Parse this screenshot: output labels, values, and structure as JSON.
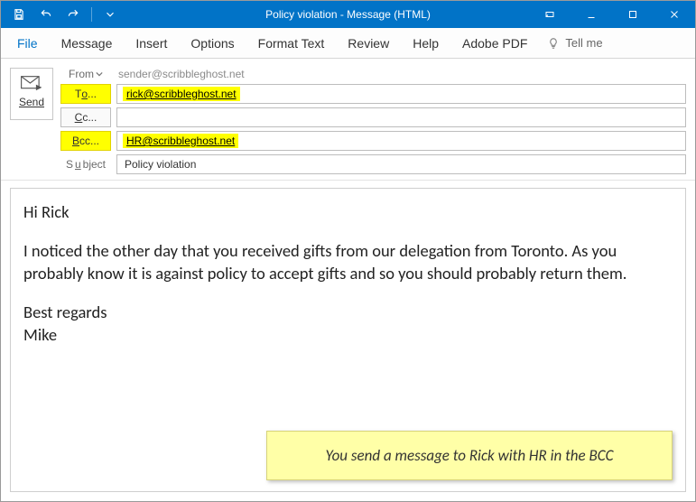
{
  "window": {
    "title": "Policy violation  -  Message (HTML)"
  },
  "ribbon": {
    "file": "File",
    "tabs": [
      "Message",
      "Insert",
      "Options",
      "Format Text",
      "Review",
      "Help",
      "Adobe PDF"
    ],
    "tellme": "Tell me"
  },
  "compose": {
    "send_label": "Send",
    "from_label": "From",
    "from_value": "sender@scribbleghost.net",
    "to_label_pre": "T",
    "to_label_u": "o",
    "to_label_post": "...",
    "to_value": "rick@scribbleghost.net",
    "cc_label_u": "C",
    "cc_label_post": "c...",
    "cc_value": "",
    "bcc_label_u": "B",
    "bcc_label_post": "cc...",
    "bcc_value": "HR@scribbleghost.net",
    "subject_label_pre": "S",
    "subject_label_u": "u",
    "subject_label_post": "bject",
    "subject_value": "Policy violation"
  },
  "body": {
    "p1": "Hi Rick",
    "p2": "I noticed the other day that you received gifts from our delegation from Toronto. As you probably know it is against policy to accept gifts and so you should probably return them.",
    "p3": "Best regards",
    "p4": "Mike"
  },
  "callout": {
    "text": "You send a message to Rick with HR in the BCC"
  }
}
